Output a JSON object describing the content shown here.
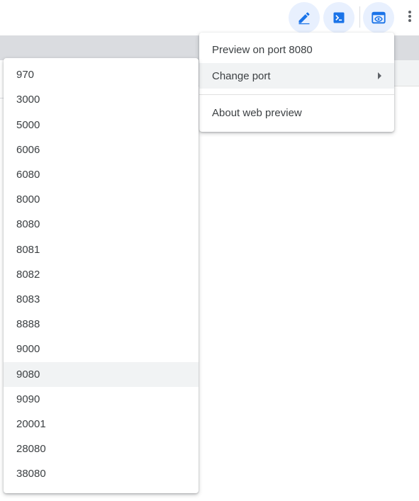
{
  "toolbar": {
    "buttons": [
      {
        "icon": "pencil-icon",
        "name": "open-editor-button"
      },
      {
        "icon": "terminal-icon",
        "name": "open-terminal-button"
      },
      {
        "icon": "web-preview-icon",
        "name": "web-preview-button"
      }
    ],
    "more_icon": "more-vert-icon"
  },
  "web_preview_menu": {
    "items": [
      {
        "label": "Preview on port 8080",
        "has_submenu": false
      },
      {
        "label": "Change port",
        "has_submenu": true,
        "highlighted": true
      },
      {
        "label": "About web preview",
        "has_submenu": false
      }
    ]
  },
  "port_menu": {
    "ports": [
      "970",
      "3000",
      "5000",
      "6006",
      "6080",
      "8000",
      "8080",
      "8081",
      "8082",
      "8083",
      "8888",
      "9000",
      "9080",
      "9090",
      "20001",
      "28080",
      "38080"
    ],
    "highlighted": "9080"
  },
  "colors": {
    "accent": "#1a73e8",
    "button_bg": "#e8f0fe",
    "highlight": "#f1f3f4",
    "text": "#3c4043"
  }
}
